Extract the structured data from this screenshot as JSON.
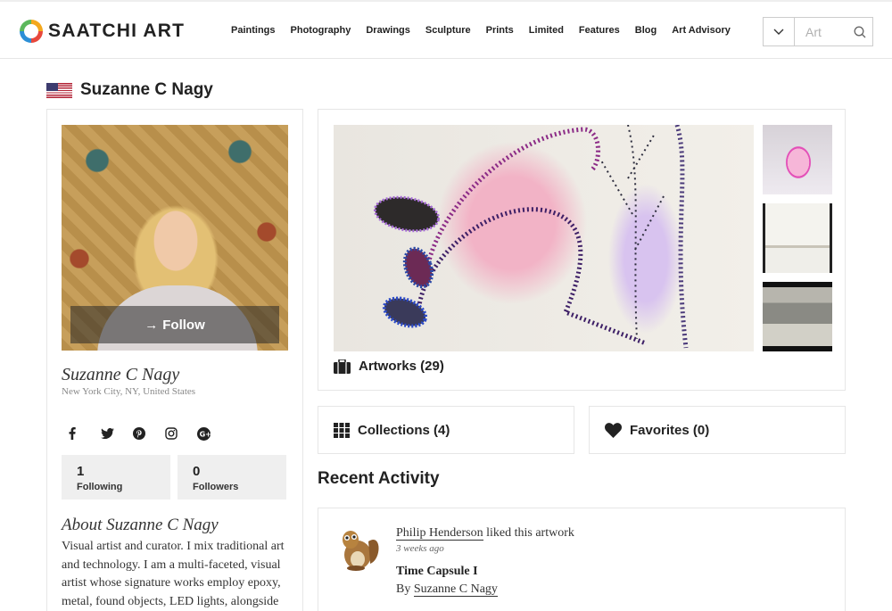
{
  "brand": {
    "name": "SAATCHI ART"
  },
  "nav": {
    "items": [
      "Paintings",
      "Photography",
      "Drawings",
      "Sculpture",
      "Prints",
      "Limited",
      "Features",
      "Blog",
      "Art Advisory"
    ]
  },
  "search": {
    "placeholder": "Art"
  },
  "profile": {
    "page_title": "Suzanne C Nagy",
    "name": "Suzanne C Nagy",
    "location": "New York City, NY, United States",
    "follow_label": "Follow",
    "social_icons": [
      "facebook-icon",
      "twitter-icon",
      "pinterest-icon",
      "instagram-icon",
      "google-plus-icon"
    ],
    "stats": [
      {
        "value": "1",
        "label": "Following"
      },
      {
        "value": "0",
        "label": "Followers"
      }
    ],
    "about_title": "About Suzanne C Nagy",
    "about_text": "Visual artist and curator. I mix traditional art and technology. I am a multi-faceted, visual artist whose signature works employ epoxy, metal, found objects, LED lights, alongside"
  },
  "artworks": {
    "label": "Artworks (29)"
  },
  "collections": {
    "label": "Collections (4)"
  },
  "favorites": {
    "label": "Favorites (0)"
  },
  "recent_activity": {
    "title": "Recent Activity",
    "items": [
      {
        "user": "Philip Henderson",
        "action": " liked this artwork",
        "time": "3 weeks ago",
        "work": "Time Capsule I",
        "by_prefix": "By ",
        "artist": "Suzanne C Nagy"
      }
    ]
  },
  "colors": {
    "accent_text": "#222222",
    "border": "#e6e6e6",
    "stat_bg": "#efefef"
  }
}
